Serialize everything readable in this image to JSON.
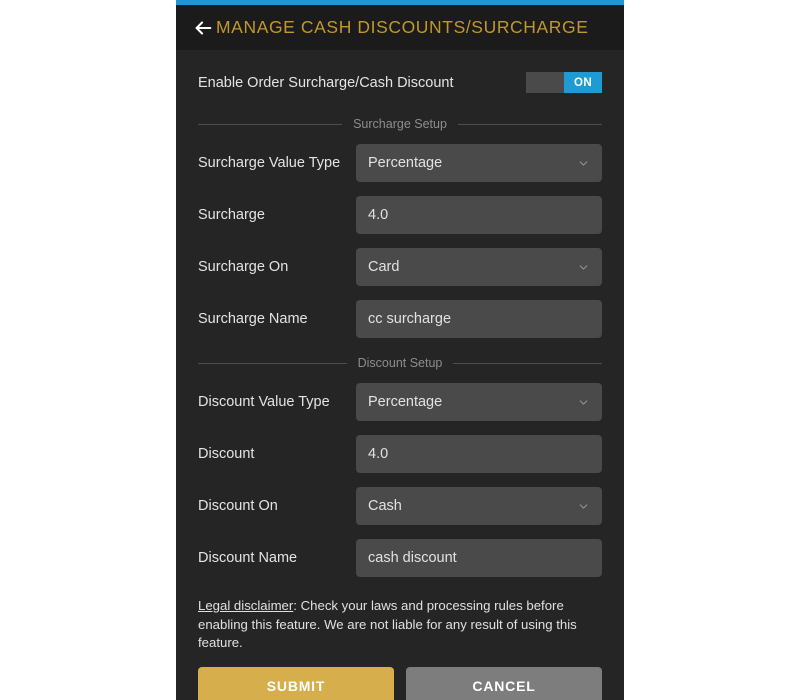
{
  "header": {
    "title": "MANAGE CASH DISCOUNTS/SURCHARGE",
    "back_icon": "arrow-left-icon",
    "accent_color": "#2196d4",
    "title_color": "#c2972c"
  },
  "enable_row": {
    "label": "Enable Order Surcharge/Cash Discount",
    "toggle_state": "ON",
    "toggle_on_color": "#1f9bd4"
  },
  "surcharge_section": {
    "title": "Surcharge Setup",
    "fields": [
      {
        "label": "Surcharge Value Type",
        "value": "Percentage",
        "type": "dropdown"
      },
      {
        "label": "Surcharge",
        "value": "4.0",
        "type": "text"
      },
      {
        "label": "Surcharge On",
        "value": "Card",
        "type": "dropdown"
      },
      {
        "label": "Surcharge Name",
        "value": "cc surcharge",
        "type": "text"
      }
    ]
  },
  "discount_section": {
    "title": "Discount Setup",
    "fields": [
      {
        "label": "Discount Value Type",
        "value": "Percentage",
        "type": "dropdown"
      },
      {
        "label": "Discount",
        "value": "4.0",
        "type": "text"
      },
      {
        "label": "Discount On",
        "value": "Cash",
        "type": "dropdown"
      },
      {
        "label": "Discount Name",
        "value": "cash discount",
        "type": "text"
      }
    ]
  },
  "disclaimer": {
    "term": "Legal disclaimer",
    "body": ": Check your laws and processing rules before enabling this feature. We are not liable for any result of using this feature."
  },
  "actions": {
    "submit_label": "SUBMIT",
    "cancel_label": "CANCEL",
    "submit_color": "#d6ae4b",
    "cancel_color": "#7d7d7d"
  }
}
